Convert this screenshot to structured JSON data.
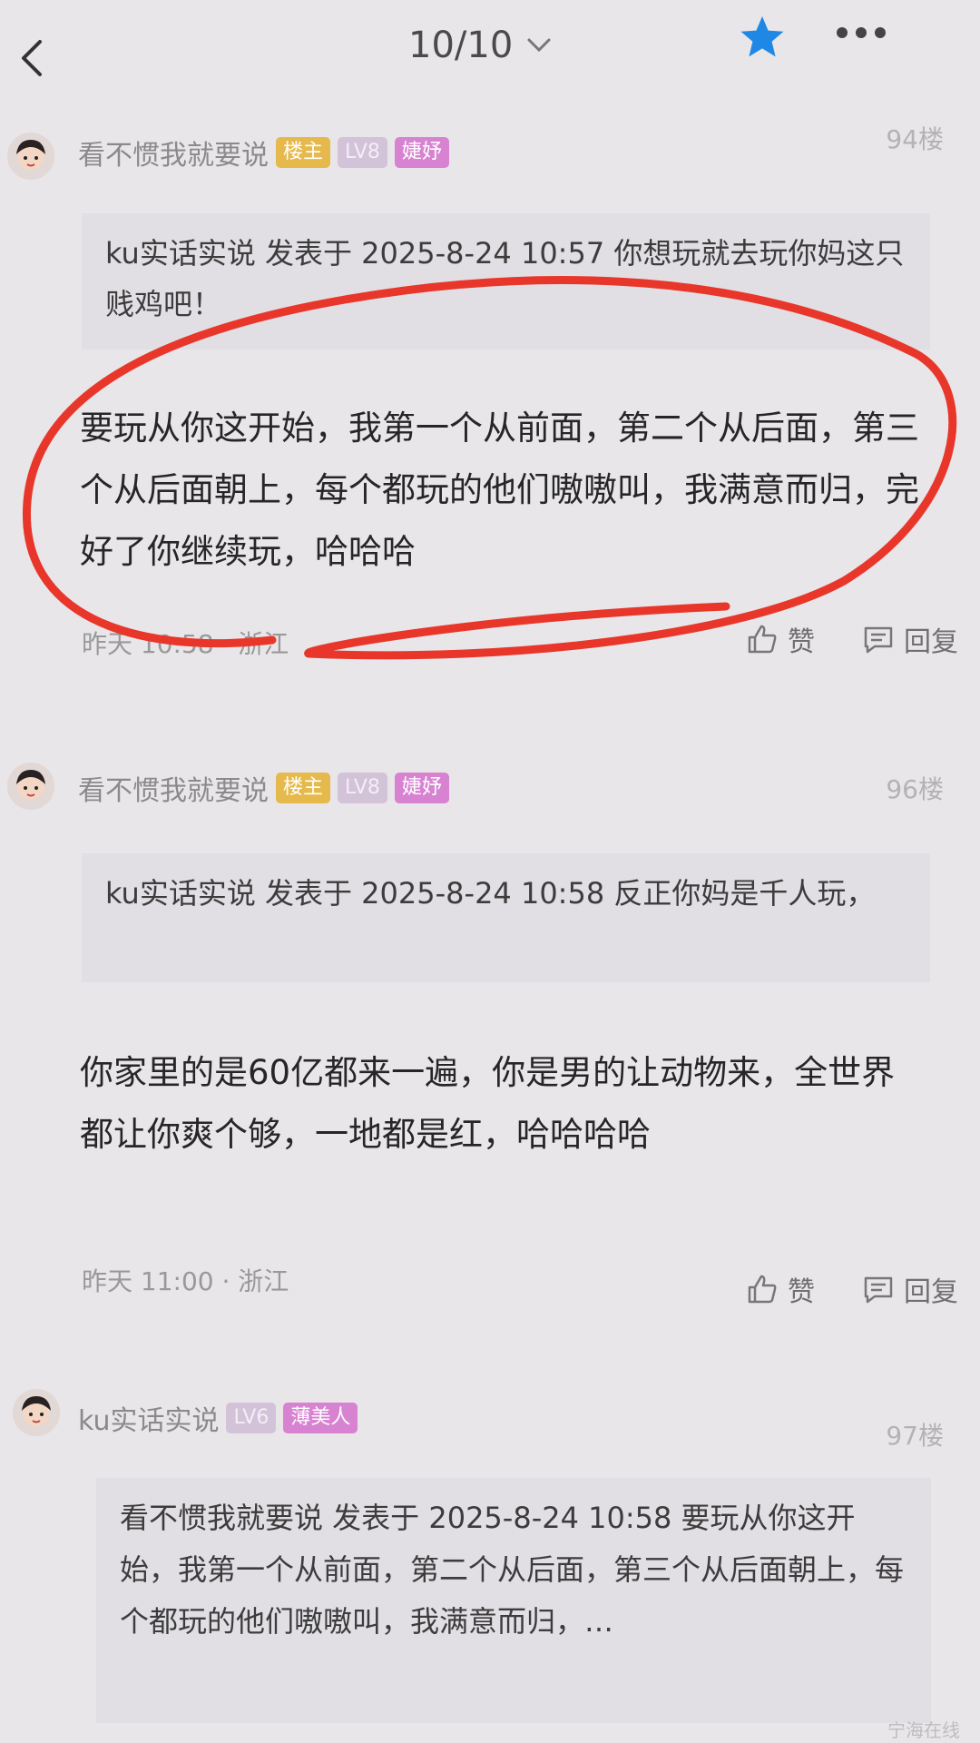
{
  "header": {
    "page_indicator": "10/10",
    "icons": [
      "back-arrow-icon",
      "chevron-down-icon",
      "star-icon",
      "more-dots-icon"
    ],
    "accent_color": "#1f88e5"
  },
  "posts": [
    {
      "username": "看不惯我就要说",
      "badges": [
        "楼主",
        "LV8",
        "婕妤"
      ],
      "floor": "94楼",
      "quote": "ku实话实说 发表于 2025-8-24 10:57 你想玩就去玩你妈这只贱鸡吧！",
      "body": "要玩从你这开始，我第一个从前面，第二个从后面，第三个从后面朝上，每个都玩的他们嗷嗷叫，我满意而归，完好了你继续玩，哈哈哈",
      "meta": "昨天 10:58 · 浙江",
      "like_label": "赞",
      "reply_label": "回复"
    },
    {
      "username": "看不惯我就要说",
      "badges": [
        "楼主",
        "LV8",
        "婕妤"
      ],
      "floor": "96楼",
      "quote": "ku实话实说 发表于 2025-8-24 10:58 反正你妈是千人玩，",
      "body": "你家里的是60亿都来一遍，你是男的让动物来，全世界都让你爽个够，一地都是红，哈哈哈哈",
      "meta": "昨天 11:00 · 浙江",
      "like_label": "赞",
      "reply_label": "回复"
    },
    {
      "username": "ku实话实说",
      "badges": [
        "LV6",
        "薄美人"
      ],
      "floor": "97楼",
      "quote": "看不惯我就要说 发表于 2025-8-24 10:58 要玩从你这开始，我第一个从前面，第二个从后面，第三个从后面朝上，每个都玩的他们嗷嗷叫，我满意而归，…"
    }
  ],
  "annotation": {
    "shape": "hand-drawn red circle around floor 94 reply",
    "color": "#e8372a"
  },
  "watermark": "宁海在线"
}
